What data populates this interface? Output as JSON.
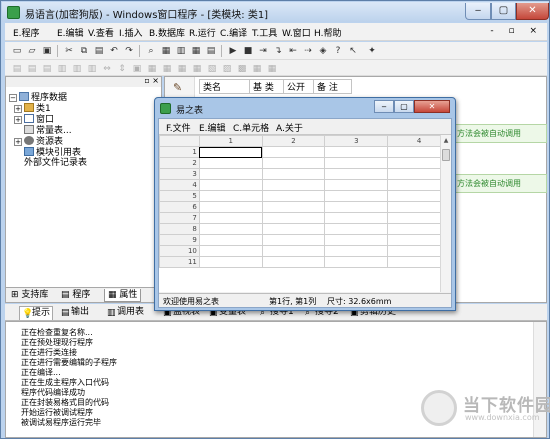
{
  "window": {
    "title": "易语言(加密狗版) - Windows窗口程序 - [类模块: 类1]"
  },
  "menubar": {
    "items": [
      "E.程序",
      "E.编辑",
      "V.查看",
      "I.插入",
      "B.数据库",
      "R.运行",
      "C.编译",
      "T.工具",
      "W.窗口",
      "H.帮助"
    ],
    "mdi_controls": "- ▫ ×"
  },
  "tree": {
    "root": "程序数据",
    "items": [
      "类1",
      "窗口",
      "常量表...",
      "资源表",
      "模块引用表",
      "外部文件记录表"
    ]
  },
  "left_tabs": [
    "支持库",
    "程序",
    "属性"
  ],
  "class_table": {
    "headers": [
      "类名",
      "基 类",
      "公开",
      "备 注"
    ]
  },
  "notes": {
    "note1": "方法会被自动调用",
    "note2": "方法会被自动调用"
  },
  "dialog": {
    "title": "易之表",
    "menu": [
      "F.文件",
      "E.编辑",
      "C.单元格",
      "A.关于"
    ],
    "columns": [
      "1",
      "2",
      "3",
      "4"
    ],
    "rows": [
      "1",
      "2",
      "3",
      "4",
      "5",
      "6",
      "7",
      "8",
      "9",
      "10",
      "11"
    ],
    "status_welcome": "欢迎使用易之表",
    "status_pos": "第1行, 第1列",
    "status_size": "尺寸: 32.6x6mm"
  },
  "output_tabs": [
    "提示",
    "输出",
    "调用表",
    "监视表",
    "变量表",
    "搜寻1",
    "搜寻2",
    "剪辑历史"
  ],
  "output_lines": [
    "正在检查重复名称...",
    "正在预处理现行程序",
    "正在进行类连接",
    "正在进行需要编辑的子程序",
    "正在编译...",
    "正在生成主程序入口代码",
    "程序代码编译成功",
    "正在封装易格式目的代码",
    "开始运行被调试程序",
    "被调试易程序运行完毕"
  ],
  "watermark": {
    "text": "当下软件园",
    "url": "www.downxia.com"
  }
}
